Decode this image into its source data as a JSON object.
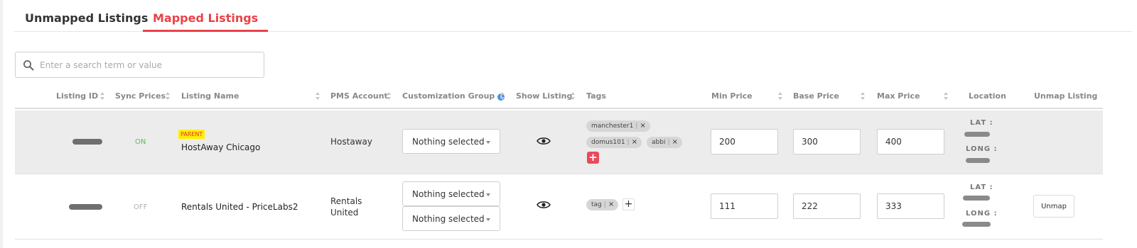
{
  "tabs": [
    {
      "label": "Unmapped Listings",
      "active": false
    },
    {
      "label": "Mapped Listings",
      "active": true
    }
  ],
  "search": {
    "placeholder": "Enter a search term or value",
    "value": ""
  },
  "columns": {
    "listing_id": "Listing ID",
    "sync_prices": "Sync Prices",
    "listing_name": "Listing Name",
    "pms_account": "PMS Account",
    "customization_group": "Customization Group",
    "show_listing": "Show Listing",
    "tags": "Tags",
    "min_price": "Min Price",
    "base_price": "Base Price",
    "max_price": "Max Price",
    "location": "Location",
    "unmap_listing": "Unmap Listing"
  },
  "rows": [
    {
      "sync": "ON",
      "badge": "PARENT",
      "name": "HostAway Chicago",
      "pms": "Hostaway",
      "group_selects": [
        "Nothing selected"
      ],
      "tags": [
        "manchester1",
        "domus101",
        "abbi"
      ],
      "min_price": "200",
      "base_price": "300",
      "max_price": "400",
      "lat_label": "LAT :",
      "long_label": "LONG :",
      "unmap_label": ""
    },
    {
      "sync": "OFF",
      "badge": "",
      "name": "Rentals United - PriceLabs2",
      "pms": "Rentals United",
      "group_selects": [
        "Nothing selected",
        "Nothing selected"
      ],
      "tags": [
        "tag"
      ],
      "min_price": "111",
      "base_price": "222",
      "max_price": "333",
      "lat_label": "LAT :",
      "long_label": "LONG :",
      "unmap_label": "Unmap"
    }
  ],
  "tag_remove_glyph": "×",
  "tag_add_glyph": "+",
  "info_glyph": "i",
  "colors": {
    "accent": "#ea4249",
    "sync_on": "#5cb85c",
    "sync_off": "#b0b0b0",
    "parent_badge": "#ffee00",
    "info": "#4a90e2"
  },
  "icons": {
    "search": "search-icon",
    "eye": "eye-icon",
    "sort": "sort-icon",
    "info": "info-icon"
  }
}
